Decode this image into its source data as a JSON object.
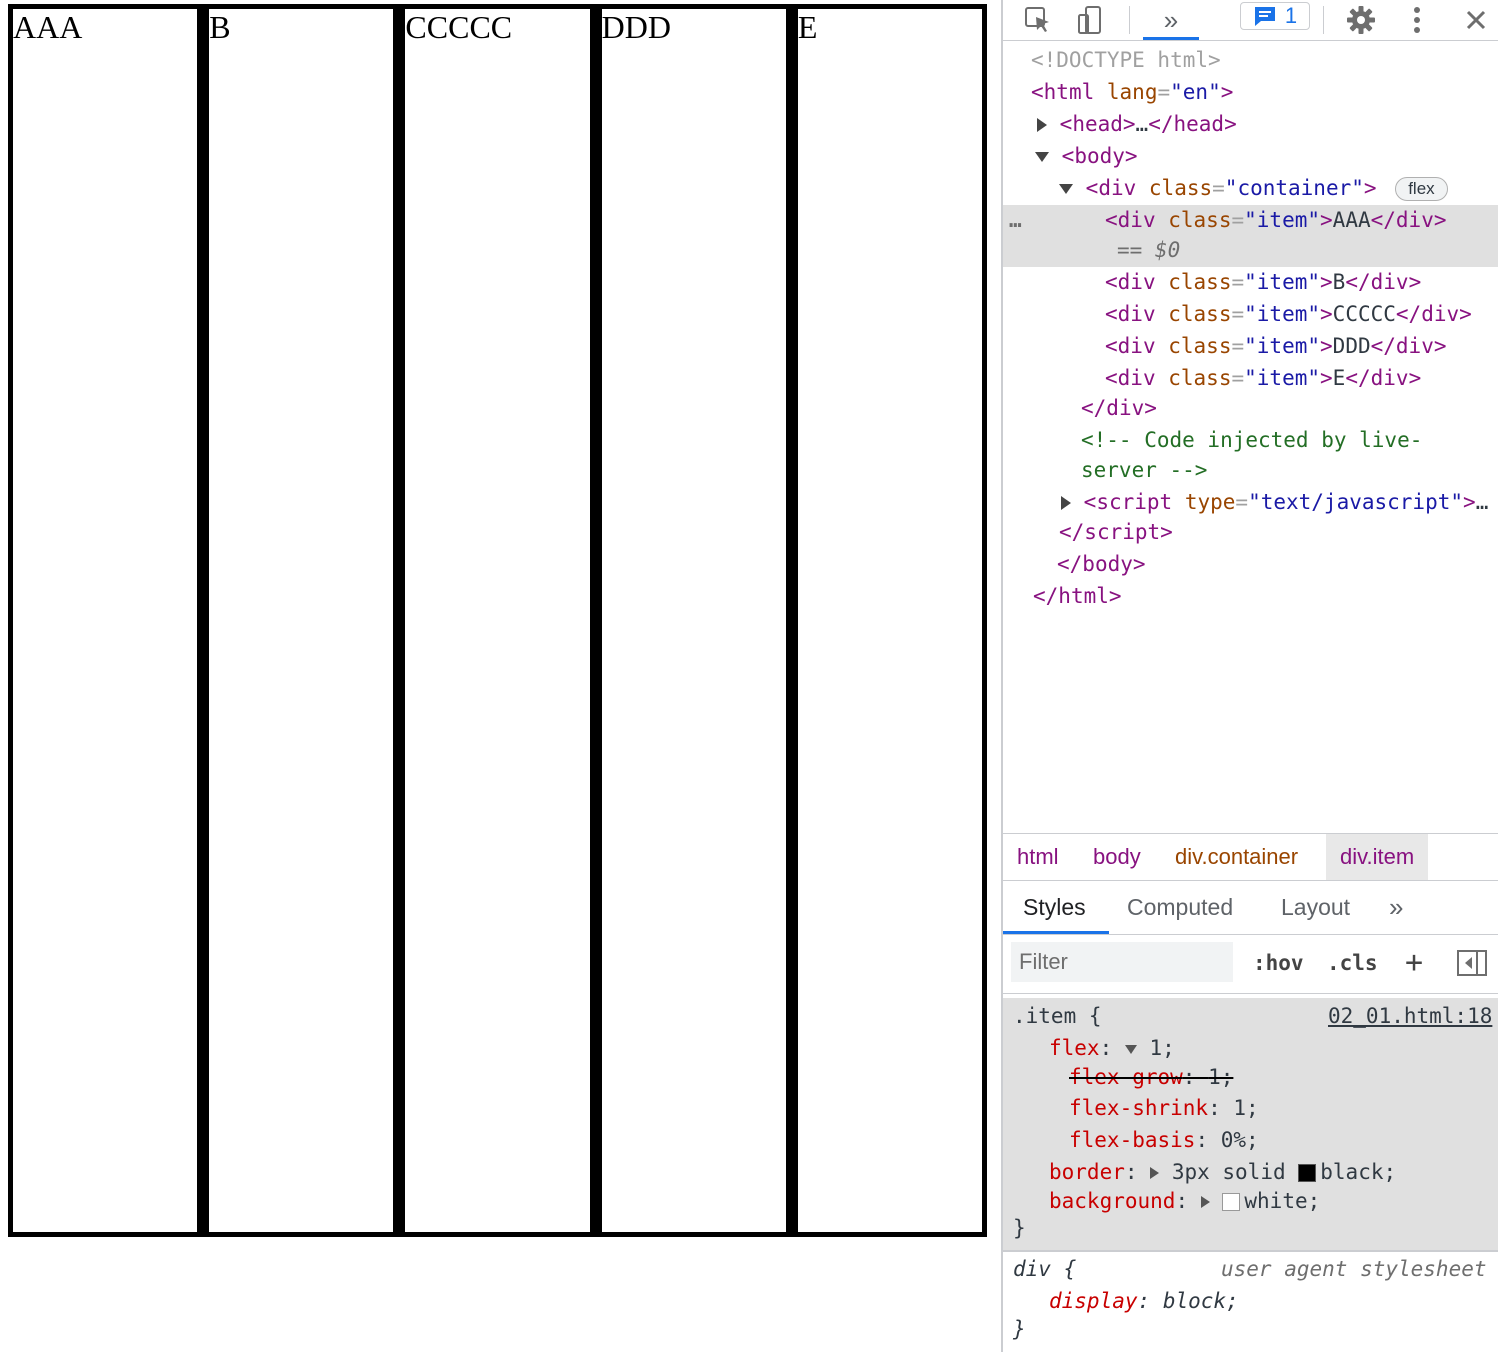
{
  "page": {
    "items": [
      "AAA",
      "B",
      "CCCCC",
      "DDD",
      "E"
    ]
  },
  "devtools": {
    "toolbar": {
      "inspect_icon": "inspect-element-icon",
      "device_icon": "device-toolbar-icon",
      "more_tabs": "»",
      "issues_count": "1",
      "settings_icon": "gear-icon",
      "menu_icon": "kebab-icon",
      "close_icon": "close-icon"
    },
    "dom": {
      "doctype": "<!DOCTYPE html>",
      "html_tag": "html",
      "html_attr": "lang",
      "html_val": "en",
      "head_tag": "head",
      "head_ellipsis": "…",
      "body_tag": "body",
      "container_tag": "div",
      "container_attr": "class",
      "container_val": "container",
      "flex_badge": "flex",
      "item_tag": "div",
      "item_attr": "class",
      "item_val": "item",
      "item_texts": [
        "AAA",
        "B",
        "CCCCC",
        "DDD",
        "E"
      ],
      "selected_marker": "== $0",
      "row_dots": "…",
      "comment_line1": "<!-- Code injected by live-",
      "comment_line2": "server -->",
      "script_tag": "script",
      "script_attr": "type",
      "script_val": "text/javascript",
      "script_trailing": "…",
      "close_div": "div",
      "close_script": "script",
      "close_body": "body",
      "close_html": "html"
    },
    "breadcrumbs": [
      "html",
      "body",
      "div.container",
      "div.item"
    ],
    "subtabs": [
      "Styles",
      "Computed",
      "Layout",
      "»"
    ],
    "filter": {
      "placeholder": "Filter",
      "hov": ":hov",
      "cls": ".cls",
      "plus": "+"
    },
    "styles": {
      "rule1": {
        "selector": ".item {",
        "source": "02_01.html:18",
        "flex_name": "flex",
        "flex_value": "1;",
        "grow_name": "flex-grow",
        "grow_value": "1;",
        "shrink_name": "flex-shrink",
        "shrink_value": "1;",
        "basis_name": "flex-basis",
        "basis_value": "0%;",
        "border_name": "border",
        "border_value": "3px solid",
        "border_color": "black;",
        "border_swatch": "#000000",
        "bg_name": "background",
        "bg_color": "white;",
        "bg_swatch": "#ffffff",
        "close": "}"
      },
      "rule2": {
        "selector": "div {",
        "source": "user agent stylesheet",
        "display_name": "display",
        "display_value": "block;",
        "close": "}"
      }
    }
  }
}
